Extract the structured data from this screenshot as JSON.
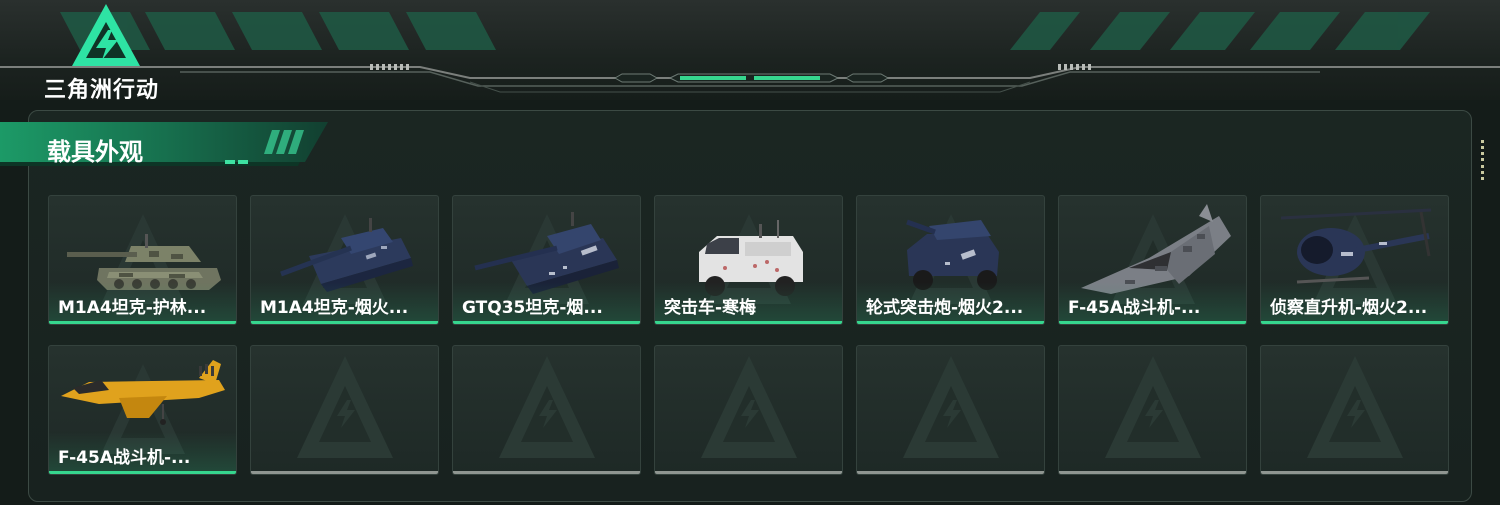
{
  "app": {
    "logo_text": "三角洲行动"
  },
  "section": {
    "title": "载具外观"
  },
  "colors": {
    "accent": "#36d68e",
    "panel_border": "#3c4a44",
    "empty_underline": "#8f9691"
  },
  "items": [
    {
      "name": "M1A4坦克-护林...",
      "icon": "tank-camo-icon"
    },
    {
      "name": "M1A4坦克-烟火...",
      "icon": "tank-navy-icon"
    },
    {
      "name": "GTQ35坦克-烟...",
      "icon": "tank-navy-2026-icon"
    },
    {
      "name": "突击车-寒梅",
      "icon": "assault-vehicle-white-icon"
    },
    {
      "name": "轮式突击炮-烟火2...",
      "icon": "wheeled-assault-gun-icon"
    },
    {
      "name": "F-45A战斗机-...",
      "icon": "fighter-jet-gray-camo-icon"
    },
    {
      "name": "侦察直升机-烟火2...",
      "icon": "scout-helicopter-icon"
    },
    {
      "name": "F-45A战斗机-...",
      "icon": "fighter-jet-yellow-icon"
    }
  ],
  "empty_slots": 6
}
